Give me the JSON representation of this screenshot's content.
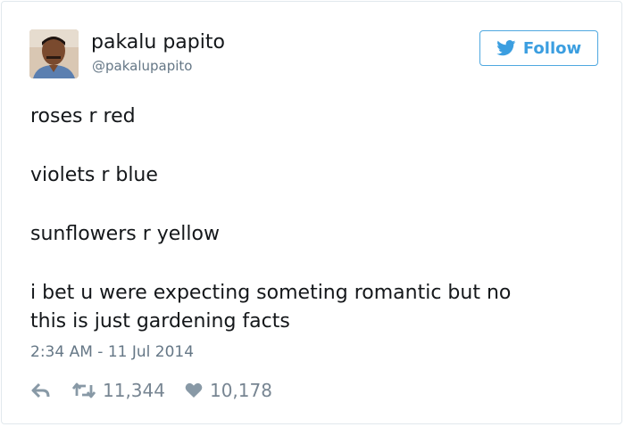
{
  "author": {
    "display_name": "pakalu papito",
    "handle": "@pakalupapito",
    "avatar_icon": "user-avatar-photo"
  },
  "follow_button": {
    "label": "Follow",
    "icon": "twitter-bird-icon",
    "color": "#3b9ee0"
  },
  "tweet": {
    "lines": [
      "roses r red",
      "violets r blue",
      "sunflowers r yellow",
      "i bet u were expecting someting romantic but no",
      "this is just gardening facts"
    ],
    "timestamp": "2:34 AM - 11 Jul 2014"
  },
  "actions": {
    "reply_icon": "reply-icon",
    "retweet_icon": "retweet-icon",
    "retweet_count": "11,344",
    "like_icon": "heart-icon",
    "like_count": "10,178"
  }
}
